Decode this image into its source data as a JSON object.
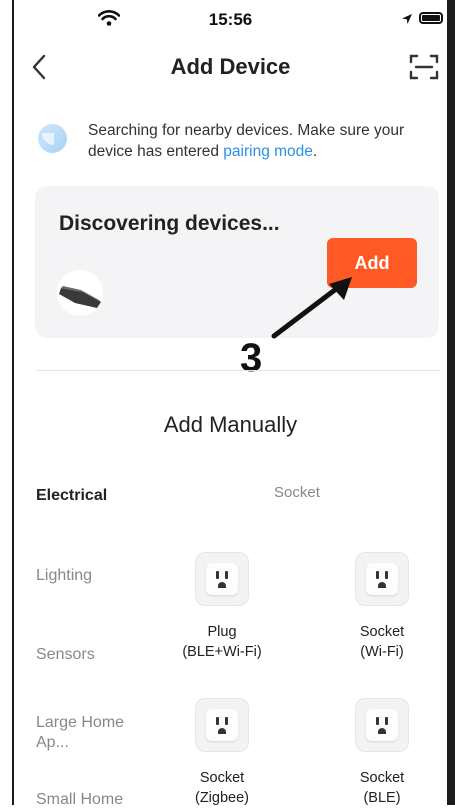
{
  "status_bar": {
    "time": "15:56"
  },
  "header": {
    "title": "Add Device"
  },
  "search_hint": {
    "text": "Searching for nearby devices. Make sure your device has entered ",
    "link": "pairing mode",
    "suffix": "."
  },
  "discovery": {
    "title": "Discovering devices...",
    "add_label": "Add"
  },
  "annotation": {
    "number": "3"
  },
  "manual": {
    "title": "Add Manually",
    "section_label": "Socket",
    "categories": [
      "Electrical",
      "Lighting",
      "Sensors",
      "Large Home Ap...",
      "Small Home"
    ],
    "devices": [
      {
        "line1": "Plug",
        "line2": "(BLE+Wi-Fi)",
        "icon": "outlet-icon"
      },
      {
        "line1": "Socket",
        "line2": "(Wi-Fi)",
        "icon": "outlet-icon"
      },
      {
        "line1": "Socket",
        "line2": "(Zigbee)",
        "icon": "outlet-icon"
      },
      {
        "line1": "Socket",
        "line2": "(BLE)",
        "icon": "outlet-icon"
      }
    ]
  },
  "colors": {
    "accent": "#ff5a26",
    "link": "#2d8fe6",
    "card_bg": "#f4f4f6"
  }
}
